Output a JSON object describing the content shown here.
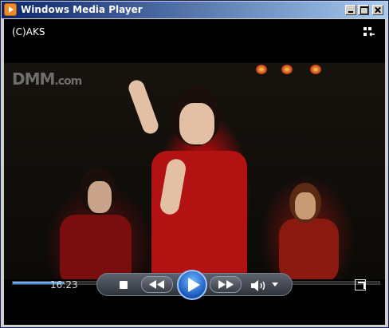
{
  "window": {
    "title": "Windows Media Player"
  },
  "player": {
    "header_text": "(C)AKS",
    "video": {
      "watermark": "DMM",
      "watermark_suffix": ".com"
    },
    "progress": 0.14,
    "time_display": "16:23",
    "icons": {
      "app": "wmp-app-icon",
      "switch_view": "switch-to-library-icon",
      "stop": "stop-icon",
      "previous": "rewind-icon",
      "play": "play-icon",
      "next": "fast-forward-icon",
      "volume": "speaker-icon",
      "volume_menu": "chevron-down-icon",
      "fullscreen": "fullscreen-icon"
    }
  },
  "colors": {
    "title_bar": "#0a246a",
    "accent": "#1e5fc2",
    "background": "#000000"
  }
}
